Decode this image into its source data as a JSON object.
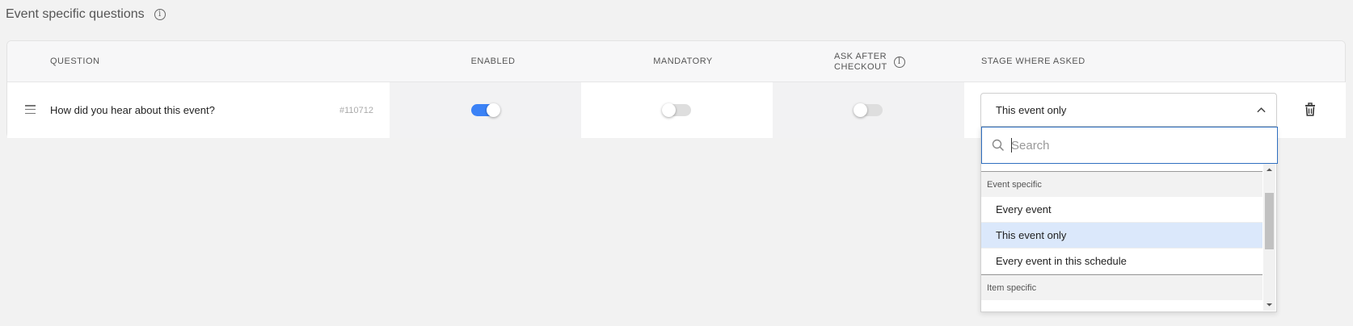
{
  "section": {
    "title": "Event specific questions",
    "info_icon": "info-icon"
  },
  "table": {
    "headers": {
      "question": "QUESTION",
      "enabled": "ENABLED",
      "mandatory": "MANDATORY",
      "ask_after_checkout_line1": "ASK AFTER",
      "ask_after_checkout_line2": "CHECKOUT",
      "stage": "STAGE WHERE ASKED"
    },
    "rows": [
      {
        "question": "How did you hear about this event?",
        "id": "#110712",
        "enabled": true,
        "mandatory": false,
        "ask_after_checkout": false,
        "stage": "This event only"
      }
    ]
  },
  "dropdown": {
    "search_placeholder": "Search",
    "search_value": "",
    "groups": [
      {
        "label": "Event specific",
        "options": [
          "Every event",
          "This event only",
          "Every event in this schedule"
        ]
      },
      {
        "label": "Item specific",
        "options": []
      }
    ],
    "selected": "This event only"
  },
  "colors": {
    "accent": "#3b82f6",
    "selected_bg": "#dbe8fb",
    "focus_border": "#2f6fc0"
  }
}
